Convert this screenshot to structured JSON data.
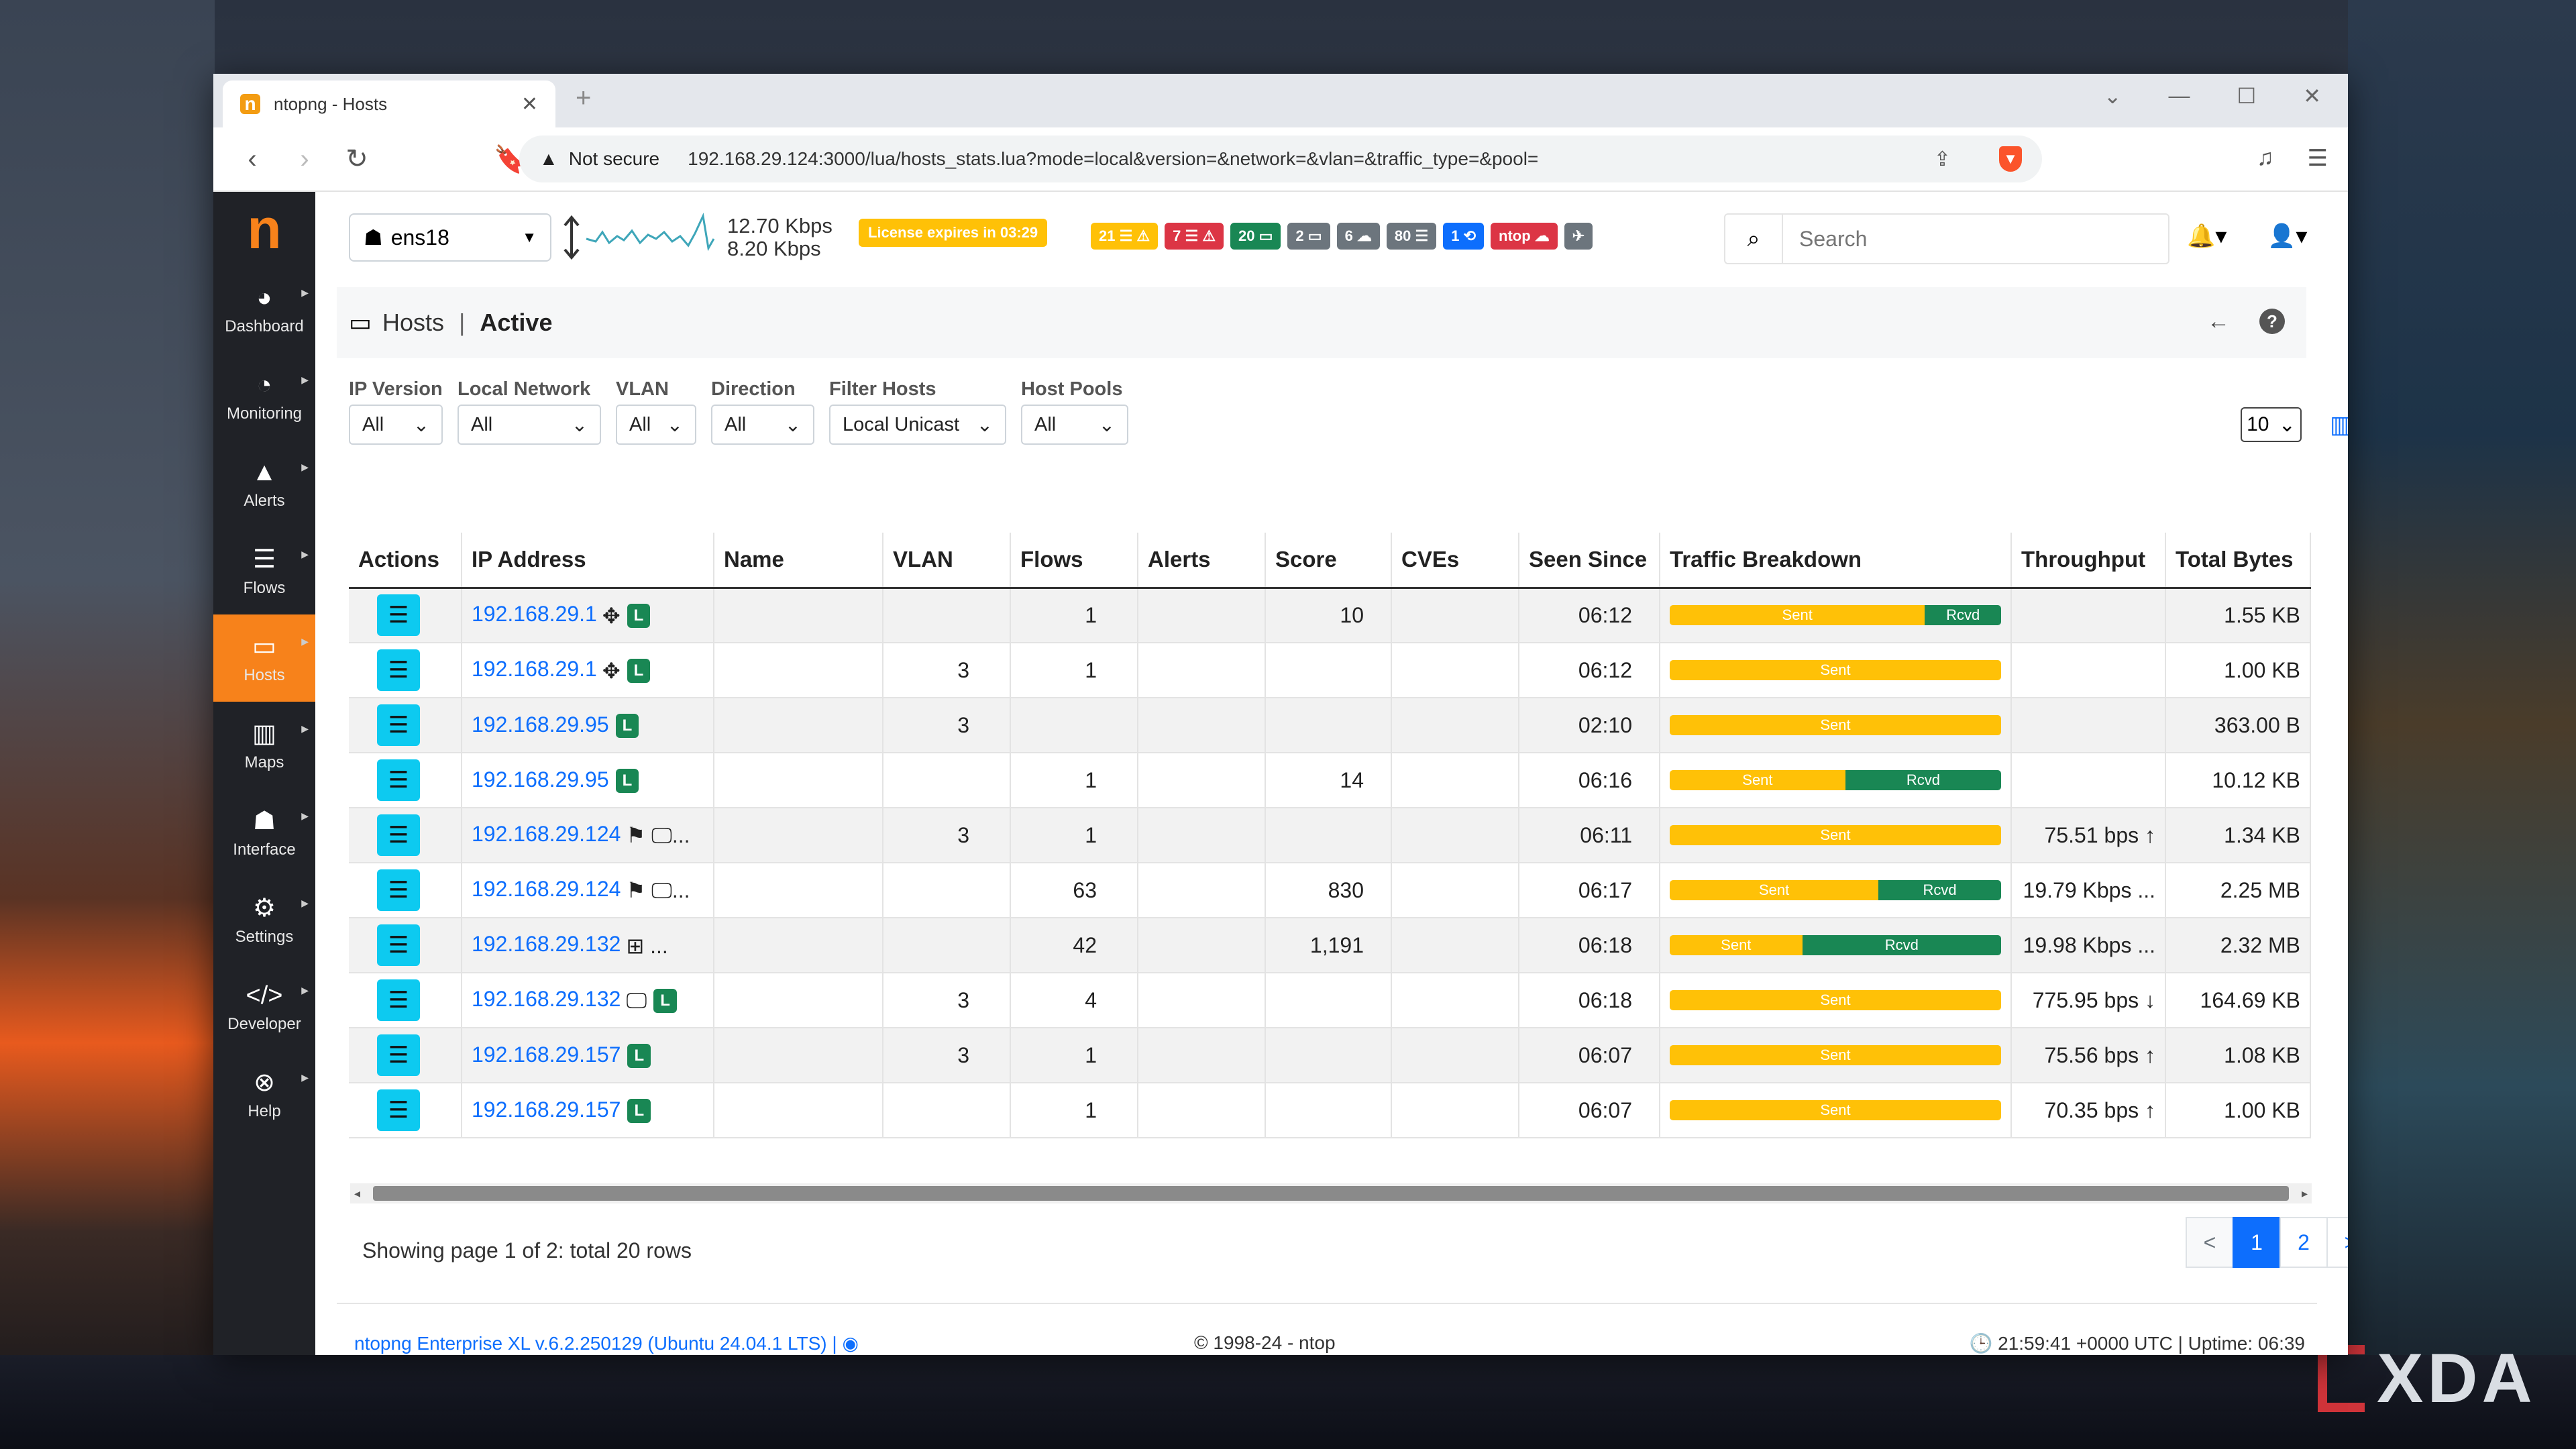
{
  "browser": {
    "tab_title": "ntopng - Hosts",
    "not_secure": "Not secure",
    "url": "192.168.29.124:3000/lua/hosts_stats.lua?mode=local&version=&network=&vlan=&traffic_type=&pool="
  },
  "sidebar": {
    "logo": "n",
    "items": [
      {
        "label": "Dashboard",
        "icon": "gauge-icon"
      },
      {
        "label": "Monitoring",
        "icon": "monitoring-icon"
      },
      {
        "label": "Alerts",
        "icon": "alert-icon"
      },
      {
        "label": "Flows",
        "icon": "flows-icon"
      },
      {
        "label": "Hosts",
        "icon": "laptop-icon"
      },
      {
        "label": "Maps",
        "icon": "map-icon"
      },
      {
        "label": "Interface",
        "icon": "interface-icon"
      },
      {
        "label": "Settings",
        "icon": "gear-icon"
      },
      {
        "label": "Developer",
        "icon": "code-icon"
      },
      {
        "label": "Help",
        "icon": "lifebuoy-icon"
      }
    ],
    "active": "Hosts"
  },
  "topbar": {
    "interface": "ens18",
    "rate_up": "12.70 Kbps",
    "rate_down": "8.20 Kbps",
    "license": "License expires in 03:29",
    "badges": [
      {
        "text": "21 ☰ ⚠",
        "color": "#ffc107"
      },
      {
        "text": "7 ☰ ⚠",
        "color": "#dc3545"
      },
      {
        "text": "20 ▭",
        "color": "#198754"
      },
      {
        "text": "2 ▭",
        "color": "#6c757d"
      },
      {
        "text": "6 ☁",
        "color": "#6c757d"
      },
      {
        "text": "80 ☰",
        "color": "#6c757d"
      },
      {
        "text": "1 ⟲",
        "color": "#0d6efd"
      },
      {
        "text": "ntop ☁",
        "color": "#dc3545"
      },
      {
        "text": "✈",
        "color": "#6c757d"
      }
    ],
    "search_placeholder": "Search"
  },
  "page": {
    "title": "Hosts",
    "separator": "|",
    "subtitle": "Active"
  },
  "filters": [
    {
      "label": "IP Version",
      "value": "All"
    },
    {
      "label": "Local Network",
      "value": "All"
    },
    {
      "label": "VLAN",
      "value": "All"
    },
    {
      "label": "Direction",
      "value": "All"
    },
    {
      "label": "Filter Hosts",
      "value": "Local Unicast"
    },
    {
      "label": "Host Pools",
      "value": "All"
    }
  ],
  "per_page": "10",
  "table": {
    "columns": [
      "Actions",
      "IP Address",
      "Name",
      "VLAN",
      "Flows",
      "Alerts",
      "Score",
      "CVEs",
      "Seen Since",
      "Traffic Breakdown",
      "Throughput",
      "Total Bytes"
    ],
    "rows": [
      {
        "ip": "192.168.29.1",
        "icons": "✥",
        "local": "L",
        "vlan": "",
        "flows": "1",
        "score": "10",
        "seen": "06:12",
        "sent": 0.77,
        "throughput": "",
        "bytes": "1.55 KB"
      },
      {
        "ip": "192.168.29.1",
        "icons": "✥",
        "local": "L",
        "vlan": "3",
        "flows": "1",
        "score": "",
        "seen": "06:12",
        "sent": 1.0,
        "throughput": "",
        "bytes": "1.00 KB"
      },
      {
        "ip": "192.168.29.95",
        "icons": "",
        "local": "L",
        "vlan": "3",
        "flows": "",
        "score": "",
        "seen": "02:10",
        "sent": 1.0,
        "throughput": "",
        "bytes": "363.00 B"
      },
      {
        "ip": "192.168.29.95",
        "icons": "",
        "local": "L",
        "vlan": "",
        "flows": "1",
        "score": "14",
        "seen": "06:16",
        "sent": 0.53,
        "throughput": "",
        "bytes": "10.12 KB"
      },
      {
        "ip": "192.168.29.124",
        "icons": "⚑ 🖵...",
        "local": "",
        "vlan": "3",
        "flows": "1",
        "score": "",
        "seen": "06:11",
        "sent": 1.0,
        "throughput": "75.51 bps ↑",
        "bytes": "1.34 KB"
      },
      {
        "ip": "192.168.29.124",
        "icons": "⚑ 🖵...",
        "local": "",
        "vlan": "",
        "flows": "63",
        "score": "830",
        "seen": "06:17",
        "sent": 0.63,
        "throughput": "19.79 Kbps ...",
        "bytes": "2.25 MB"
      },
      {
        "ip": "192.168.29.132",
        "icons": "⊞ ...",
        "local": "",
        "vlan": "",
        "flows": "42",
        "score": "1,191",
        "seen": "06:18",
        "sent": 0.4,
        "throughput": "19.98 Kbps ...",
        "bytes": "2.32 MB"
      },
      {
        "ip": "192.168.29.132",
        "icons": "🖵",
        "local": "L",
        "vlan": "3",
        "flows": "4",
        "score": "",
        "seen": "06:18",
        "sent": 1.0,
        "throughput": "775.95 bps ↓",
        "bytes": "164.69 KB"
      },
      {
        "ip": "192.168.29.157",
        "icons": "",
        "local": "L",
        "vlan": "3",
        "flows": "1",
        "score": "",
        "seen": "06:07",
        "sent": 1.0,
        "throughput": "75.56 bps ↑",
        "bytes": "1.08 KB"
      },
      {
        "ip": "192.168.29.157",
        "icons": "",
        "local": "L",
        "vlan": "",
        "flows": "1",
        "score": "",
        "seen": "06:07",
        "sent": 1.0,
        "throughput": "70.35 bps ↑",
        "bytes": "1.00 KB"
      }
    ],
    "sent_label": "Sent",
    "rcvd_label": "Rcvd"
  },
  "pagination": {
    "showing": "Showing page 1 of 2: total 20 rows",
    "prev": "<",
    "pages": [
      "1",
      "2"
    ],
    "next": ">"
  },
  "footer": {
    "version": "ntopng Enterprise XL v.6.2.250129 (Ubuntu 24.04.1 LTS) |",
    "copyright": "© 1998-24 - ntop",
    "status": "21:59:41 +0000 UTC | Uptime: 06:39"
  },
  "watermark": "XDA",
  "colors": {
    "accent": "#f7821b",
    "link": "#0d6efd",
    "sent": "#ffc107",
    "rcvd": "#198754"
  }
}
